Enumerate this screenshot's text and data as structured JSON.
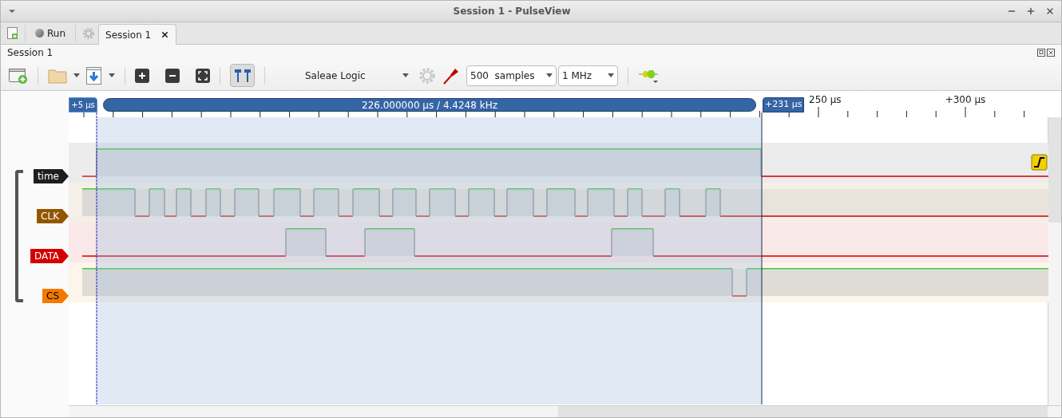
{
  "window": {
    "title": "Session 1 - PulseView"
  },
  "main_toolbar": {
    "run_label": "Run"
  },
  "tabs": [
    {
      "label": "Session 1",
      "selected": true
    }
  ],
  "session": {
    "title": "Session 1"
  },
  "device": {
    "name": "Saleae Logic"
  },
  "sample_count": {
    "value": "500  samples"
  },
  "sample_rate": {
    "value": "1 MHz"
  },
  "ruler": {
    "ticks": [
      "250 µs",
      "+300 µs"
    ]
  },
  "cursors": {
    "start": "+5 µs",
    "span": "226.000000 µs / 4.4248 kHz",
    "end": "+231 µs"
  },
  "channels": [
    {
      "name": "time",
      "color": "#1e1e1e"
    },
    {
      "name": "CLK",
      "color": "#935600"
    },
    {
      "name": "DATA",
      "color": "#d40000"
    },
    {
      "name": "CS",
      "color": "#f57900"
    }
  ]
}
